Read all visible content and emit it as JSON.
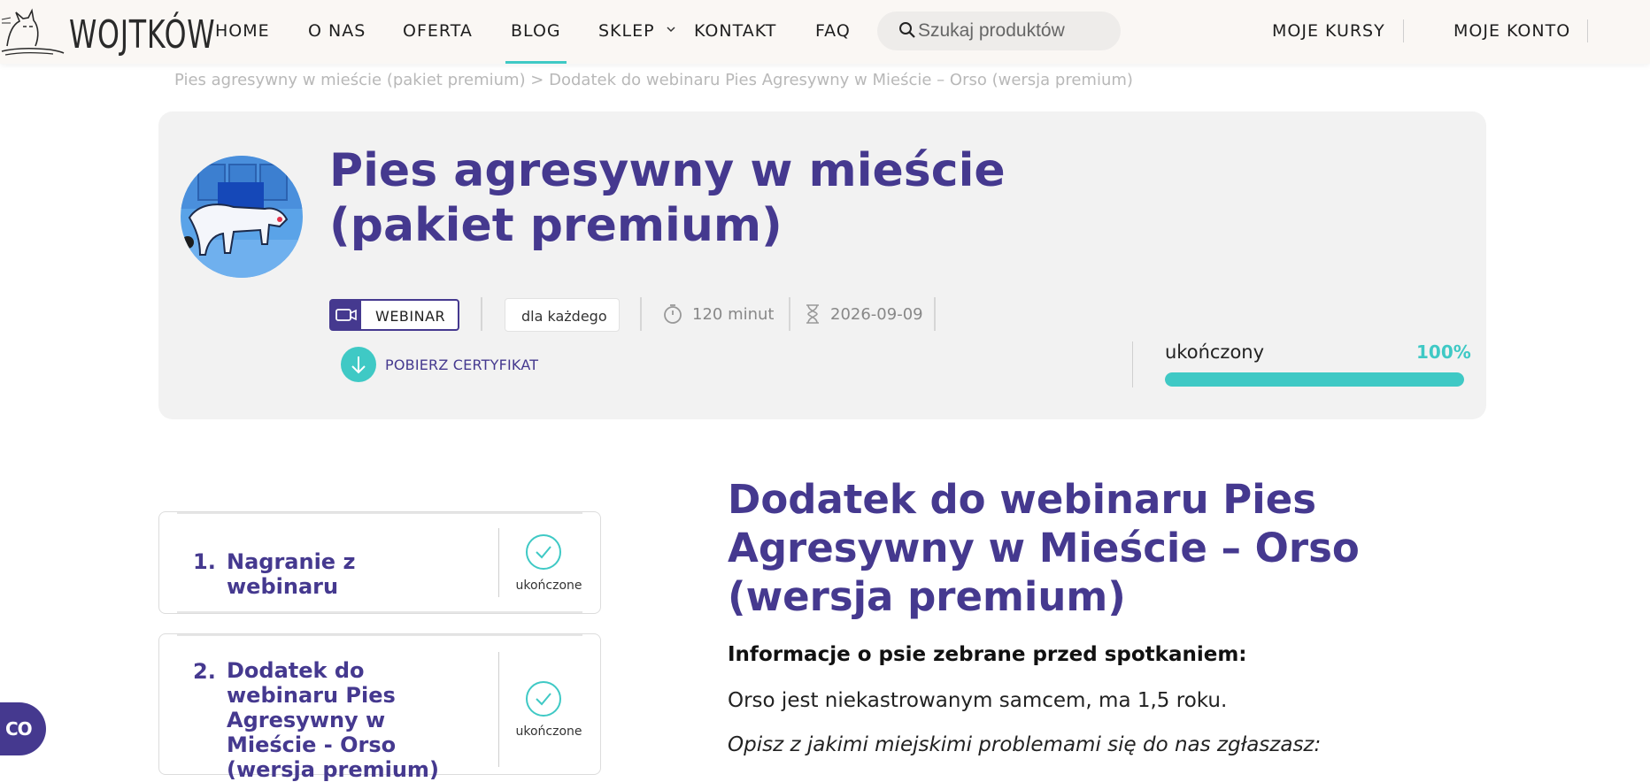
{
  "brand": {
    "name": "WOJTKÓW"
  },
  "nav": {
    "items": [
      {
        "label": "HOME"
      },
      {
        "label": "O NAS"
      },
      {
        "label": "OFERTA"
      },
      {
        "label": "BLOG"
      },
      {
        "label": "SKLEP"
      },
      {
        "label": "KONTAKT"
      },
      {
        "label": "FAQ"
      }
    ],
    "active": "BLOG",
    "search_placeholder": "Szukaj produktów",
    "my_courses": "MOJE KURSY",
    "my_account": "MOJE KONTO"
  },
  "breadcrumb": "Pies agresywny w mieście (pakiet premium) > Dodatek do webinaru Pies Agresywny w Mieście – Orso (wersja premium)",
  "course": {
    "title": "Pies agresywny w mieście (pakiet premium)",
    "type_tag": "WEBINAR",
    "audience_tag": "dla każdego",
    "duration": "120 minut",
    "expiry_date": "2026-09-09",
    "certificate_label": "POBIERZ CERTYFIKAT",
    "progress_label": "ukończony",
    "progress_percent_text": "100%",
    "progress_fraction": 1.0
  },
  "lessons": [
    {
      "number": "1.",
      "title": "Nagranie z webinaru",
      "status": "ukończone"
    },
    {
      "number": "2.",
      "title": "Dodatek do webinaru Pies Agresywny w Mieście - Orso (wersja premium)",
      "status": "ukończone"
    }
  ],
  "article": {
    "title": "Dodatek do webinaru Pies Agresywny w Mieście – Orso (wersja premium)",
    "subheading": "Informacje o psie zebrane przed spotkaniem:",
    "paragraph": "Orso jest niekastrowanym samcem, ma 1,5 roku.",
    "question": "Opisz z jakimi miejskimi problemami się do nas zgłaszasz:"
  },
  "chat": {
    "label": "CO"
  },
  "colors": {
    "primary": "#45398f",
    "accent": "#3fc9c5",
    "navbar_bg": "#faf7f4",
    "hero_bg": "#f2f2f2"
  },
  "icons": [
    "cat-logo-icon",
    "search-icon",
    "chevron-down-icon",
    "video-camera-icon",
    "stopwatch-icon",
    "hourglass-icon",
    "download-icon",
    "check-icon"
  ]
}
